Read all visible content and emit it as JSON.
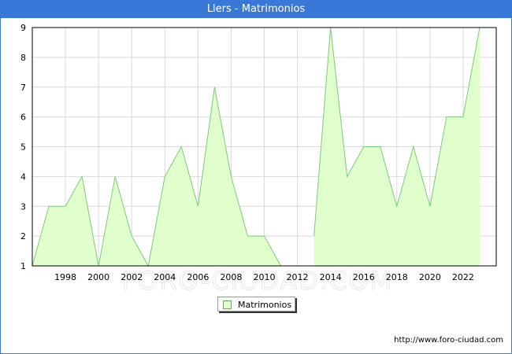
{
  "title": "Llers - Matrimonios",
  "source": "http://www.foro-ciudad.com",
  "watermark": "FORO-CIUDAD.COM",
  "colors": {
    "titlebar": "#3a78d8",
    "area_fill": "#e0ffcc",
    "area_line": "#7ec87e",
    "grid": "#d9d9d9"
  },
  "chart_data": {
    "type": "area",
    "title": "Llers - Matrimonios",
    "x": [
      1996,
      1997,
      1998,
      1999,
      2000,
      2001,
      2002,
      2003,
      2004,
      2005,
      2006,
      2007,
      2008,
      2009,
      2010,
      2011,
      2012,
      2013,
      2014,
      2015,
      2016,
      2017,
      2018,
      2019,
      2020,
      2021,
      2022,
      2023
    ],
    "series": [
      {
        "name": "Matrimonios",
        "values": [
          1,
          3,
          3,
          4,
          1,
          4,
          2,
          1,
          4,
          5,
          3,
          7,
          4,
          2,
          2,
          1,
          null,
          2,
          9,
          4,
          5,
          5,
          3,
          5,
          3,
          6,
          6,
          9
        ]
      }
    ],
    "x_ticks": [
      1998,
      2000,
      2002,
      2004,
      2006,
      2008,
      2010,
      2012,
      2014,
      2016,
      2018,
      2020,
      2022
    ],
    "y_ticks": [
      1,
      2,
      3,
      4,
      5,
      6,
      7,
      8,
      9
    ],
    "xlim": [
      1996,
      2024
    ],
    "ylim": [
      1,
      9
    ],
    "grid": true,
    "legend_position": "bottom-center",
    "legend_label": "Matrimonios"
  }
}
